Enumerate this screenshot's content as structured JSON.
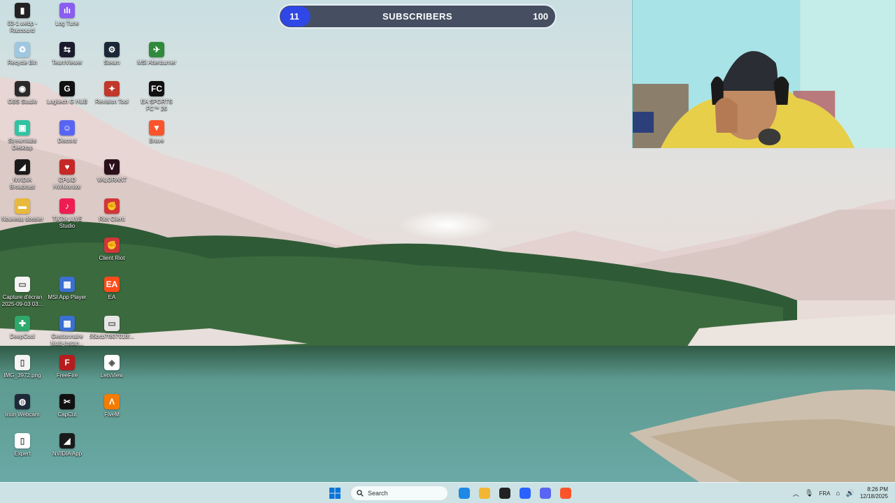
{
  "desktop": {
    "icons": [
      {
        "label": "03-1.webp - Raccourci",
        "icon": "shortcut-file-icon",
        "color": "#222222",
        "glyph": "▮"
      },
      {
        "label": "Log Tune",
        "icon": "audio-bars-icon",
        "color": "#8a5cf0",
        "glyph": "ılı"
      },
      {
        "label": "Recycle Bin",
        "icon": "recycle-bin-icon",
        "color": "#9fc7e0",
        "glyph": "♻"
      },
      {
        "label": "TeamViewer",
        "icon": "teamviewer-icon",
        "color": "#1b1b2e",
        "glyph": "⇆"
      },
      {
        "label": "Steam",
        "icon": "steam-icon",
        "color": "#1b2838",
        "glyph": "⚙"
      },
      {
        "label": "MSI Afterburner",
        "icon": "afterburner-icon",
        "color": "#2f8a3b",
        "glyph": "✈"
      },
      {
        "label": "OBS Studio",
        "icon": "obs-icon",
        "color": "#2a2a2a",
        "glyph": "◉"
      },
      {
        "label": "Logitech G HUB",
        "icon": "logitech-icon",
        "color": "#111111",
        "glyph": "G"
      },
      {
        "label": "Revision Tool",
        "icon": "revision-tool-icon",
        "color": "#c0392b",
        "glyph": "✦"
      },
      {
        "label": "EA SPORTS FC™ 26",
        "icon": "ea-fc-icon",
        "color": "#111111",
        "glyph": "FC"
      },
      {
        "label": "Streamlabs Desktop",
        "icon": "streamlabs-icon",
        "color": "#31c3a2",
        "glyph": "▣"
      },
      {
        "label": "Discord",
        "icon": "discord-icon",
        "color": "#5865f2",
        "glyph": "☺"
      },
      {
        "label": "Brave",
        "icon": "brave-icon",
        "color": "#fb542b",
        "glyph": "▼"
      },
      {
        "label": "NVIDIA Broadcast",
        "icon": "nvidia-broadcast-icon",
        "color": "#1a1a1a",
        "glyph": "◢"
      },
      {
        "label": "CPUID HWMonitor",
        "icon": "hwmonitor-icon",
        "color": "#c62828",
        "glyph": "♥"
      },
      {
        "label": "VALORANT",
        "icon": "valorant-icon",
        "color": "#2b0f1a",
        "glyph": "V"
      },
      {
        "label": "Nouveau dossier",
        "icon": "folder-icon",
        "color": "#e8b93a",
        "glyph": "▬"
      },
      {
        "label": "TikTok LIVE Studio",
        "icon": "tiktok-live-icon",
        "color": "#ee1d52",
        "glyph": "♪"
      },
      {
        "label": "Riot Client",
        "icon": "riot-client-icon",
        "color": "#d13639",
        "glyph": "✊"
      },
      {
        "label": "Client Riot",
        "icon": "riot-client-2-icon",
        "color": "#d13639",
        "glyph": "✊"
      },
      {
        "label": "Capture d'écran 2025-09-03 03...",
        "icon": "screenshot-file-icon",
        "color": "#f4f4f4",
        "glyph": "▭"
      },
      {
        "label": "MSI App Player",
        "icon": "msi-app-player-icon",
        "color": "#3b6fd1",
        "glyph": "▦"
      },
      {
        "label": "EA",
        "icon": "ea-icon",
        "color": "#ff4c1a",
        "glyph": "EA"
      },
      {
        "label": "DeepCool",
        "icon": "deepcool-icon",
        "color": "#2ea86b",
        "glyph": "✚"
      },
      {
        "label": "Gestionnaire Multi-instan...",
        "icon": "multi-instance-icon",
        "color": "#3b6fd1",
        "glyph": "▦"
      },
      {
        "label": "55bcb7f807018f...",
        "icon": "image-file-icon",
        "color": "#e6e6e6",
        "glyph": "▭"
      },
      {
        "label": "IMG_3972.png",
        "icon": "png-file-icon",
        "color": "#f4f4f4",
        "glyph": "▯"
      },
      {
        "label": "FreeFire",
        "icon": "freefire-icon",
        "color": "#b71c1c",
        "glyph": "F"
      },
      {
        "label": "LetsView",
        "icon": "letsview-icon",
        "color": "#ffffff",
        "glyph": "◈"
      },
      {
        "label": "Iriun Webcam",
        "icon": "iriun-webcam-icon",
        "color": "#1e2a38",
        "glyph": "◍"
      },
      {
        "label": "CapCut",
        "icon": "capcut-icon",
        "color": "#111111",
        "glyph": "✂"
      },
      {
        "label": "FiveM",
        "icon": "fivem-icon",
        "color": "#f57c00",
        "glyph": "Λ"
      },
      {
        "label": "Expert",
        "icon": "document-file-icon",
        "color": "#ffffff",
        "glyph": "▯"
      },
      {
        "label": "NVIDIA App",
        "icon": "nvidia-app-icon",
        "color": "#1a1a1a",
        "glyph": "◢"
      }
    ]
  },
  "subscriber_goal": {
    "current": "11",
    "label": "SUBSCRIBERS",
    "goal": "100",
    "progress": 0.11,
    "fill_color": "#2f47e6"
  },
  "taskbar": {
    "search_placeholder": "Search",
    "pinned": [
      {
        "name": "edge-icon",
        "color": "#1e88e5"
      },
      {
        "name": "file-explorer-icon",
        "color": "#f2b632"
      },
      {
        "name": "obs-icon",
        "color": "#222222"
      },
      {
        "name": "microsoft-store-icon",
        "color": "#2962ff"
      },
      {
        "name": "discord-icon",
        "color": "#5865f2"
      },
      {
        "name": "brave-icon",
        "color": "#fb542b"
      }
    ],
    "language": "FRA",
    "time": "8:26 PM",
    "date": "12/18/2025"
  },
  "colors": {
    "taskbar_bg": "#d6e8eb",
    "windows_blue": "#0a74da"
  }
}
